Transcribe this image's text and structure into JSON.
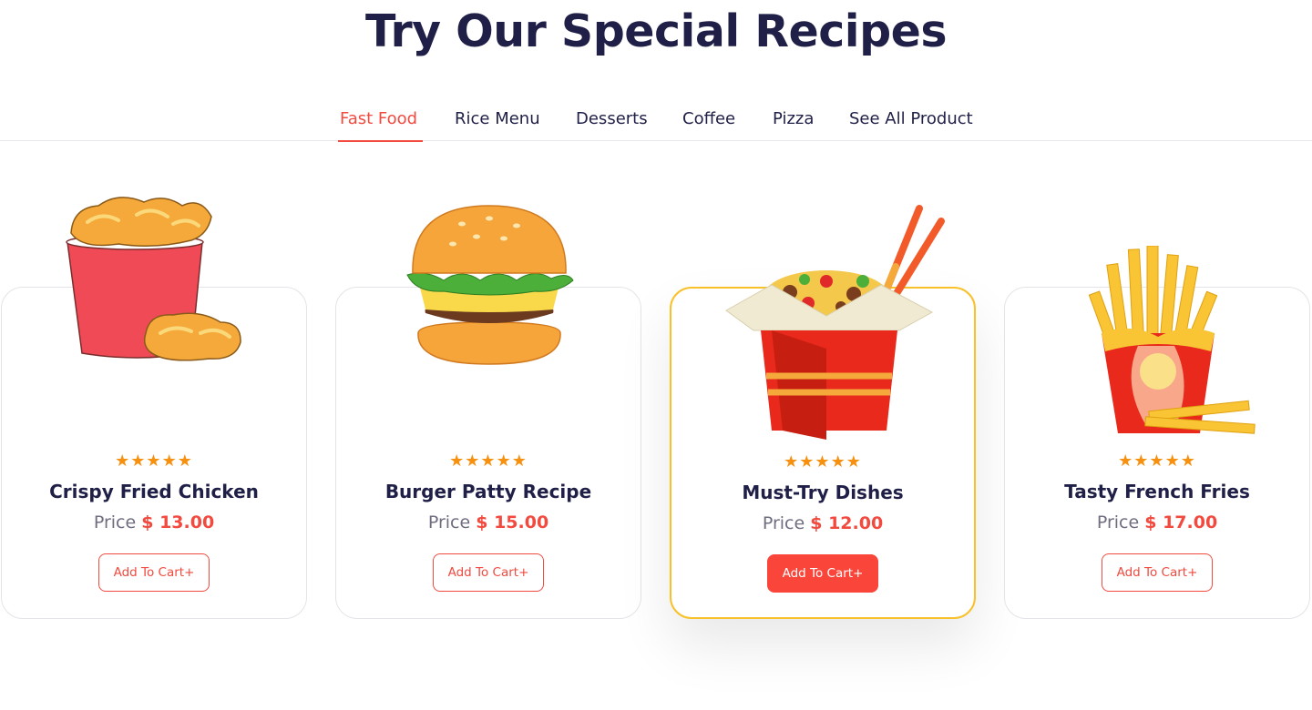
{
  "page_title": "Try Our Special Recipes",
  "tabs": [
    {
      "label": "Fast Food"
    },
    {
      "label": "Rice Menu"
    },
    {
      "label": "Desserts"
    },
    {
      "label": "Coffee"
    },
    {
      "label": "Pizza"
    },
    {
      "label": "See All Product"
    }
  ],
  "active_tab": "Fast Food",
  "colors": {
    "accent": "#f24a3f",
    "heading": "#1f1f47",
    "star": "#f7900f",
    "featured_border": "#f8c12a"
  },
  "products": [
    {
      "name": "Crispy Fried Chicken",
      "price_label": "Price",
      "price": "$ 13.00",
      "rating": "★★★★★",
      "button": "Add To Cart+",
      "icon": "fried-chicken-bucket"
    },
    {
      "name": "Burger Patty Recipe",
      "price_label": "Price",
      "price": "$ 15.00",
      "rating": "★★★★★",
      "button": "Add To Cart+",
      "icon": "burger"
    },
    {
      "name": "Must-Try Dishes",
      "price_label": "Price",
      "price": "$ 12.00",
      "rating": "★★★★★",
      "button": "Add To Cart+",
      "icon": "noodle-box"
    },
    {
      "name": "Tasty French Fries",
      "price_label": "Price",
      "price": "$ 17.00",
      "rating": "★★★★★",
      "button": "Add To Cart+",
      "icon": "french-fries"
    }
  ]
}
